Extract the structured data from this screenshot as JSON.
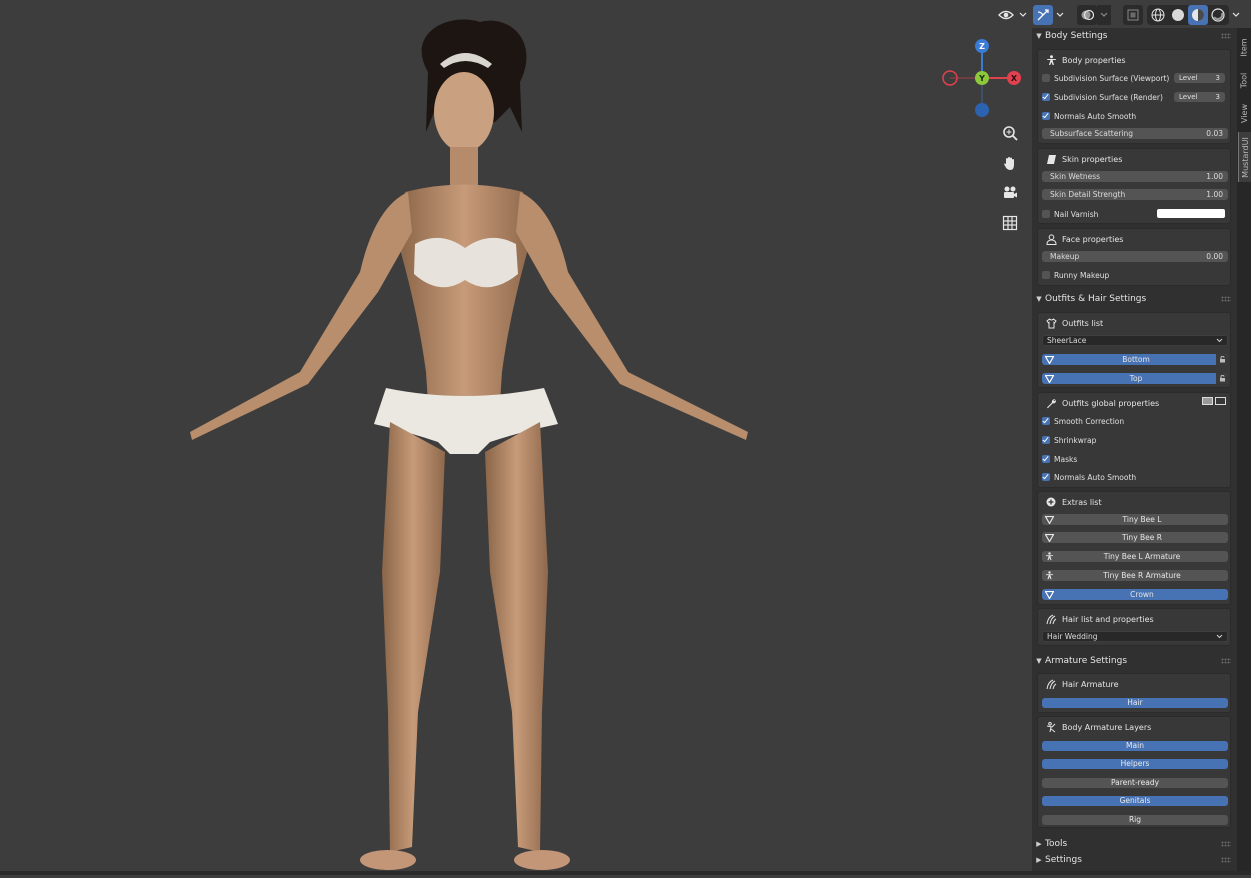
{
  "viewport": {
    "background": "#3d3d3d",
    "gizmo": {
      "z_label": "Z",
      "y_label": "Y",
      "x_label": "X"
    },
    "nav_icons": [
      "zoom-icon",
      "hand-pan-icon",
      "camera-icon",
      "grid-icon"
    ]
  },
  "header_icons": [
    "visibility-eye-icon",
    "gizmo-toggle-icon",
    "overlay-icon",
    "xray-icon",
    "wireframe-shading-icon",
    "solid-shading-icon",
    "material-shading-icon",
    "rendered-shading-icon"
  ],
  "side_tabs": [
    "Item",
    "Tool",
    "View",
    "MustardUI"
  ],
  "body_settings": {
    "title": "Body Settings",
    "body_properties": {
      "title": "Body properties",
      "subdiv_viewport": {
        "label": "Subdivision Surface (Viewport)",
        "checked": false,
        "level_label": "Level",
        "level_value": "3"
      },
      "subdiv_render": {
        "label": "Subdivision Surface (Render)",
        "checked": true,
        "level_label": "Level",
        "level_value": "3"
      },
      "normals_auto_smooth": {
        "label": "Normals Auto Smooth",
        "checked": true
      },
      "subsurface": {
        "label": "Subsurface Scattering",
        "value": "0.03"
      }
    },
    "skin_properties": {
      "title": "Skin properties",
      "wetness": {
        "label": "Skin Wetness",
        "value": "1.00"
      },
      "detail": {
        "label": "Skin Detail Strength",
        "value": "1.00"
      },
      "nail_varnish": {
        "label": "Nail Varnish",
        "checked": false,
        "color": "#ffffff"
      }
    },
    "face_properties": {
      "title": "Face properties",
      "makeup": {
        "label": "Makeup",
        "value": "0.00"
      },
      "runny_makeup": {
        "label": "Runny Makeup",
        "checked": false
      }
    }
  },
  "outfits": {
    "title": "Outfits & Hair Settings",
    "outfits_list": {
      "title": "Outfits list",
      "selected": "SheerLace",
      "items": [
        "Bottom",
        "Top"
      ]
    },
    "global": {
      "title": "Outfits global properties",
      "smooth_correction": {
        "label": "Smooth Correction",
        "checked": true
      },
      "shrinkwrap": {
        "label": "Shrinkwrap",
        "checked": true
      },
      "masks": {
        "label": "Masks",
        "checked": true
      },
      "normals_auto_smooth": {
        "label": "Normals Auto Smooth",
        "checked": true
      }
    },
    "extras": {
      "title": "Extras list",
      "items": [
        {
          "label": "Tiny Bee L",
          "active": false,
          "icon": "mesh-icon"
        },
        {
          "label": "Tiny Bee R",
          "active": false,
          "icon": "mesh-icon"
        },
        {
          "label": "Tiny Bee L Armature",
          "active": false,
          "icon": "armature-icon"
        },
        {
          "label": "Tiny Bee R Armature",
          "active": false,
          "icon": "armature-icon"
        },
        {
          "label": "Crown",
          "active": true,
          "icon": "mesh-icon"
        }
      ]
    },
    "hair": {
      "title": "Hair list and properties",
      "selected": "Hair Wedding"
    }
  },
  "armature": {
    "title": "Armature Settings",
    "hair_armature": {
      "title": "Hair Armature",
      "button": "Hair"
    },
    "body_layers": {
      "title": "Body Armature Layers",
      "layers": [
        {
          "label": "Main",
          "active": true
        },
        {
          "label": "Helpers",
          "active": true
        },
        {
          "label": "Parent-ready",
          "active": false
        },
        {
          "label": "Genitals",
          "active": true
        },
        {
          "label": "Rig",
          "active": false
        }
      ]
    }
  },
  "tools": {
    "title": "Tools"
  },
  "settings": {
    "title": "Settings"
  },
  "colors": {
    "accent": "#4772b3",
    "panel": "#303030",
    "box": "#383838",
    "field": "#545454"
  }
}
